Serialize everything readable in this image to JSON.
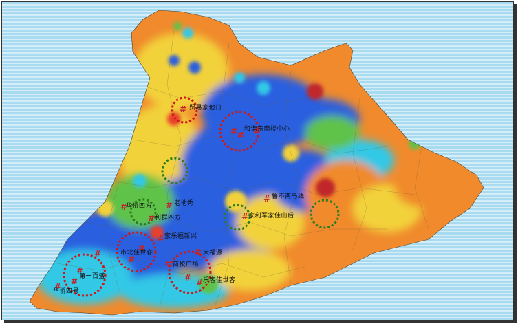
{
  "map": {
    "labels": [
      {
        "id": "l1",
        "text": "贸易家他日"
      },
      {
        "id": "l2",
        "text": "和谐东南楼中心"
      },
      {
        "id": "l3",
        "text": "华侨四方"
      },
      {
        "id": "l4",
        "text": "老他秀"
      },
      {
        "id": "l5",
        "text": "利群四方"
      },
      {
        "id": "l6",
        "text": "鲁不两马线"
      },
      {
        "id": "l7",
        "text": "家乐福新兴"
      },
      {
        "id": "l8",
        "text": "家利军家佳山后"
      },
      {
        "id": "l9",
        "text": "市北佳世客"
      },
      {
        "id": "l10",
        "text": "大福源"
      },
      {
        "id": "l11",
        "text": "商校广场"
      },
      {
        "id": "l12",
        "text": "第一百盛"
      },
      {
        "id": "l13",
        "text": "乐客佳世客"
      },
      {
        "id": "l14",
        "text": "华侨四号"
      }
    ],
    "hash_symbol": "#"
  },
  "colors": {
    "sea": "#a8dbf0",
    "sea_lines": "#ffffff",
    "hot": "#e8412a",
    "orange": "#f08a2c",
    "yellow": "#f2d23a",
    "green": "#5fc24a",
    "cyan": "#33c8e6",
    "blue": "#2a5fe0",
    "marker": "#c0262c",
    "red_circle": "#d01818",
    "green_circle": "#2e7d1e"
  }
}
